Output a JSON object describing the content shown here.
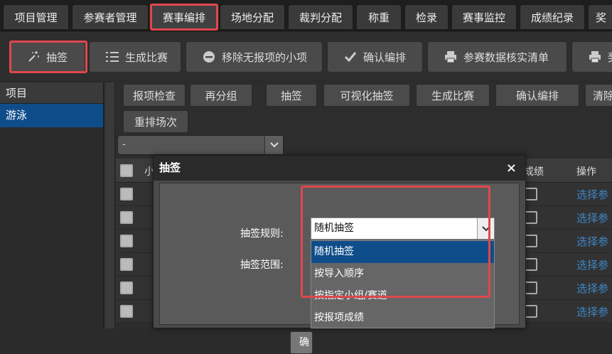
{
  "tabs": [
    "项目管理",
    "参赛者管理",
    "赛事编排",
    "场地分配",
    "裁判分配",
    "称重",
    "检录",
    "赛事监控",
    "成绩纪录",
    "奖"
  ],
  "toolbar": {
    "draw": "抽签",
    "generate": "生成比赛",
    "remove_empty": "移除无报项的小项",
    "confirm": "确认编排",
    "print_checklist": "参赛数据核实清单",
    "print_award": "奖"
  },
  "sidebar": {
    "header": "项目",
    "items": [
      "游泳"
    ]
  },
  "subbuttons": [
    "报项检查",
    "再分组",
    "抽签",
    "可视化抽签",
    "生成比赛",
    "确认编排",
    "清除",
    "重排场次"
  ],
  "filter": {
    "value": "-"
  },
  "table": {
    "header_col2": "小",
    "header_col3": "成绩",
    "header_action": "操作",
    "rows": [
      "选择参",
      "选择参",
      "选择参",
      "选择参",
      "选择参",
      "选择参"
    ]
  },
  "dialog": {
    "title": "抽签",
    "close": "×",
    "rule_label": "抽签规则:",
    "scope_label": "抽签范围:",
    "rule_value": "随机抽签",
    "options": [
      "随机抽签",
      "按导入顺序",
      "按指定小组/赛道",
      "按报项成绩"
    ],
    "button": "确"
  },
  "colors": {
    "accent_blue": "#0f4d8a",
    "highlight_red": "#e0474c",
    "link_blue": "#3d86c6"
  }
}
